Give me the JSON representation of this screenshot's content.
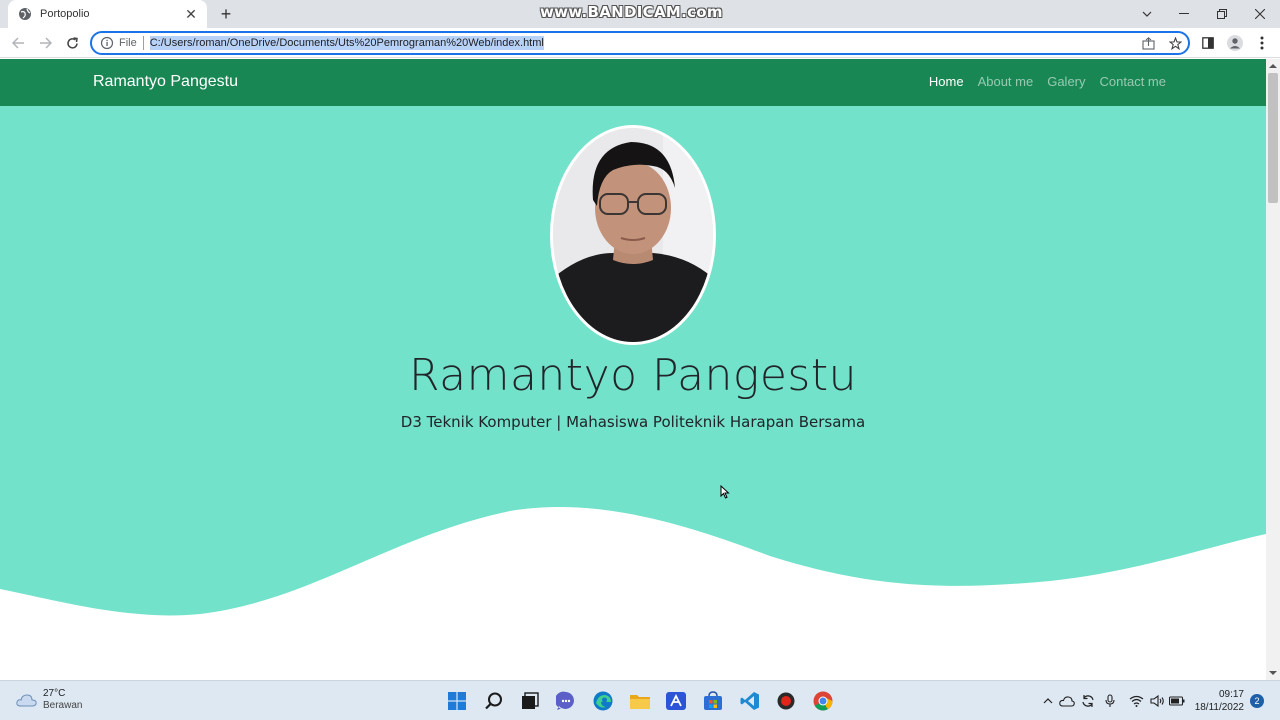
{
  "browser": {
    "tab_title": "Portopolio",
    "watermark": "www.BANDICAM.com",
    "address_scheme": "File",
    "address_url": "C:/Users/roman/OneDrive/Documents/Uts%20Pemrograman%20Web/index.html"
  },
  "site": {
    "brand": "Ramantyo Pangestu",
    "nav": [
      "Home",
      "About me",
      "Galery",
      "Contact me"
    ],
    "active_nav": "Home",
    "hero_title": "Ramantyo Pangestu",
    "hero_subtitle": "D3 Teknik Komputer | Mahasiswa Politeknik Harapan Bersama",
    "colors": {
      "navbar": "#198754",
      "hero": "#72e2ca",
      "wave": "#ffffff"
    }
  },
  "taskbar": {
    "weather_temp": "27°C",
    "weather_condition": "Berawan",
    "time": "09:17",
    "date": "18/11/2022",
    "notification_count": "2",
    "apps": [
      "start-icon",
      "search-icon",
      "task-view-icon",
      "chat-icon",
      "edge-icon",
      "file-explorer-icon",
      "app-icon",
      "store-icon",
      "vscode-icon",
      "bandicam-icon",
      "chrome-icon"
    ]
  }
}
